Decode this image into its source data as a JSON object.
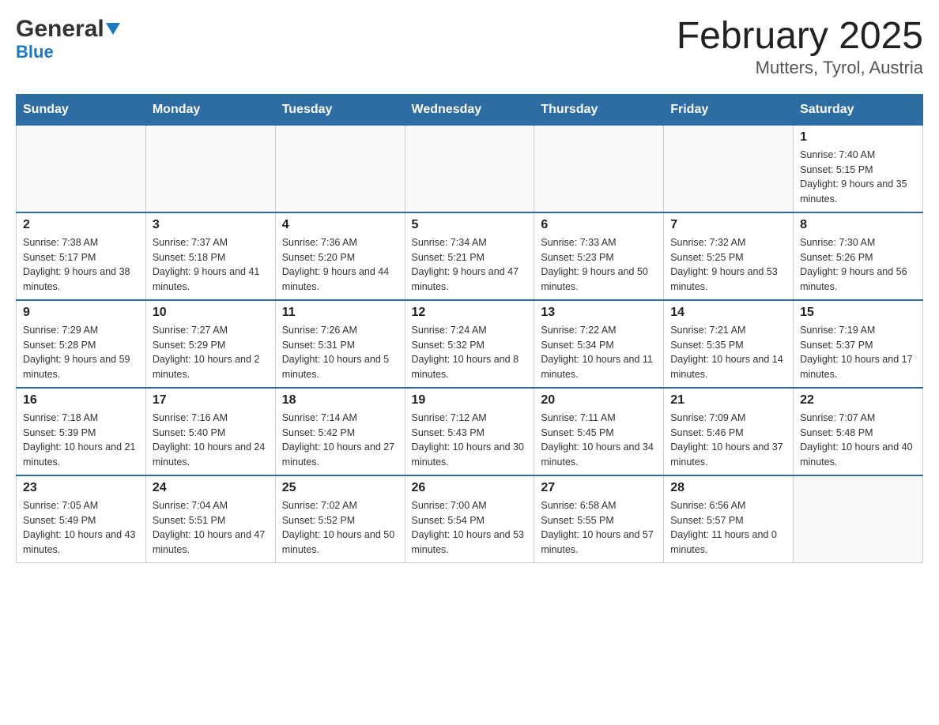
{
  "logo": {
    "general": "General",
    "blue": "Blue"
  },
  "title": "February 2025",
  "subtitle": "Mutters, Tyrol, Austria",
  "days_of_week": [
    "Sunday",
    "Monday",
    "Tuesday",
    "Wednesday",
    "Thursday",
    "Friday",
    "Saturday"
  ],
  "weeks": [
    [
      {
        "day": "",
        "info": ""
      },
      {
        "day": "",
        "info": ""
      },
      {
        "day": "",
        "info": ""
      },
      {
        "day": "",
        "info": ""
      },
      {
        "day": "",
        "info": ""
      },
      {
        "day": "",
        "info": ""
      },
      {
        "day": "1",
        "info": "Sunrise: 7:40 AM\nSunset: 5:15 PM\nDaylight: 9 hours and 35 minutes."
      }
    ],
    [
      {
        "day": "2",
        "info": "Sunrise: 7:38 AM\nSunset: 5:17 PM\nDaylight: 9 hours and 38 minutes."
      },
      {
        "day": "3",
        "info": "Sunrise: 7:37 AM\nSunset: 5:18 PM\nDaylight: 9 hours and 41 minutes."
      },
      {
        "day": "4",
        "info": "Sunrise: 7:36 AM\nSunset: 5:20 PM\nDaylight: 9 hours and 44 minutes."
      },
      {
        "day": "5",
        "info": "Sunrise: 7:34 AM\nSunset: 5:21 PM\nDaylight: 9 hours and 47 minutes."
      },
      {
        "day": "6",
        "info": "Sunrise: 7:33 AM\nSunset: 5:23 PM\nDaylight: 9 hours and 50 minutes."
      },
      {
        "day": "7",
        "info": "Sunrise: 7:32 AM\nSunset: 5:25 PM\nDaylight: 9 hours and 53 minutes."
      },
      {
        "day": "8",
        "info": "Sunrise: 7:30 AM\nSunset: 5:26 PM\nDaylight: 9 hours and 56 minutes."
      }
    ],
    [
      {
        "day": "9",
        "info": "Sunrise: 7:29 AM\nSunset: 5:28 PM\nDaylight: 9 hours and 59 minutes."
      },
      {
        "day": "10",
        "info": "Sunrise: 7:27 AM\nSunset: 5:29 PM\nDaylight: 10 hours and 2 minutes."
      },
      {
        "day": "11",
        "info": "Sunrise: 7:26 AM\nSunset: 5:31 PM\nDaylight: 10 hours and 5 minutes."
      },
      {
        "day": "12",
        "info": "Sunrise: 7:24 AM\nSunset: 5:32 PM\nDaylight: 10 hours and 8 minutes."
      },
      {
        "day": "13",
        "info": "Sunrise: 7:22 AM\nSunset: 5:34 PM\nDaylight: 10 hours and 11 minutes."
      },
      {
        "day": "14",
        "info": "Sunrise: 7:21 AM\nSunset: 5:35 PM\nDaylight: 10 hours and 14 minutes."
      },
      {
        "day": "15",
        "info": "Sunrise: 7:19 AM\nSunset: 5:37 PM\nDaylight: 10 hours and 17 minutes."
      }
    ],
    [
      {
        "day": "16",
        "info": "Sunrise: 7:18 AM\nSunset: 5:39 PM\nDaylight: 10 hours and 21 minutes."
      },
      {
        "day": "17",
        "info": "Sunrise: 7:16 AM\nSunset: 5:40 PM\nDaylight: 10 hours and 24 minutes."
      },
      {
        "day": "18",
        "info": "Sunrise: 7:14 AM\nSunset: 5:42 PM\nDaylight: 10 hours and 27 minutes."
      },
      {
        "day": "19",
        "info": "Sunrise: 7:12 AM\nSunset: 5:43 PM\nDaylight: 10 hours and 30 minutes."
      },
      {
        "day": "20",
        "info": "Sunrise: 7:11 AM\nSunset: 5:45 PM\nDaylight: 10 hours and 34 minutes."
      },
      {
        "day": "21",
        "info": "Sunrise: 7:09 AM\nSunset: 5:46 PM\nDaylight: 10 hours and 37 minutes."
      },
      {
        "day": "22",
        "info": "Sunrise: 7:07 AM\nSunset: 5:48 PM\nDaylight: 10 hours and 40 minutes."
      }
    ],
    [
      {
        "day": "23",
        "info": "Sunrise: 7:05 AM\nSunset: 5:49 PM\nDaylight: 10 hours and 43 minutes."
      },
      {
        "day": "24",
        "info": "Sunrise: 7:04 AM\nSunset: 5:51 PM\nDaylight: 10 hours and 47 minutes."
      },
      {
        "day": "25",
        "info": "Sunrise: 7:02 AM\nSunset: 5:52 PM\nDaylight: 10 hours and 50 minutes."
      },
      {
        "day": "26",
        "info": "Sunrise: 7:00 AM\nSunset: 5:54 PM\nDaylight: 10 hours and 53 minutes."
      },
      {
        "day": "27",
        "info": "Sunrise: 6:58 AM\nSunset: 5:55 PM\nDaylight: 10 hours and 57 minutes."
      },
      {
        "day": "28",
        "info": "Sunrise: 6:56 AM\nSunset: 5:57 PM\nDaylight: 11 hours and 0 minutes."
      },
      {
        "day": "",
        "info": ""
      }
    ]
  ]
}
